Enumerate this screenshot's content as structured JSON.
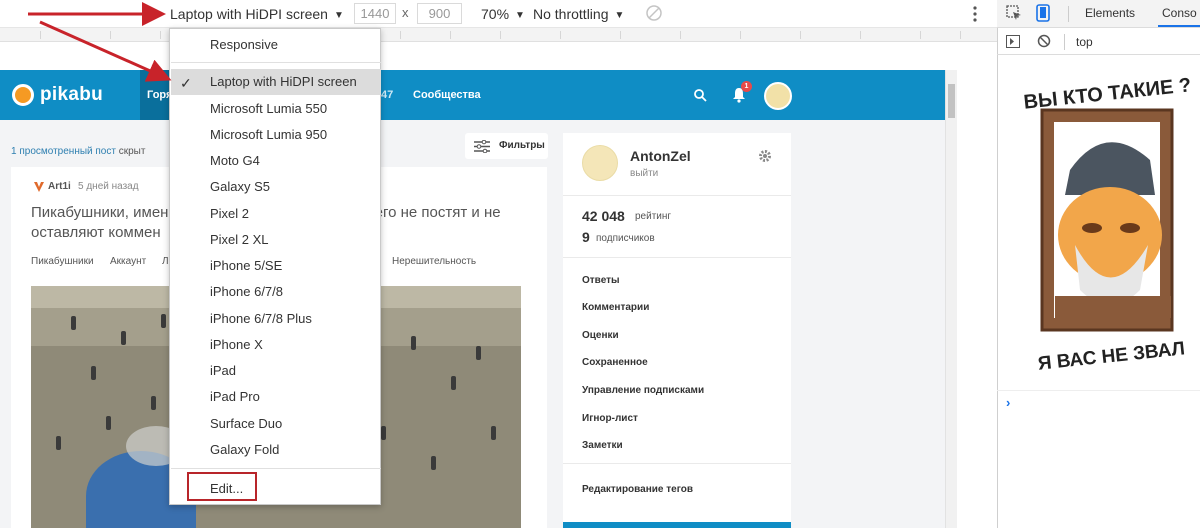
{
  "toolbar": {
    "device": "Laptop with HiDPI screen",
    "width": "1440",
    "height": "900",
    "dim_separator": "x",
    "zoom": "70%",
    "throttling": "No throttling"
  },
  "device_menu": {
    "items": [
      "Responsive",
      "Laptop with HiDPI screen",
      "Microsoft Lumia 550",
      "Microsoft Lumia 950",
      "Moto G4",
      "Galaxy S5",
      "Pixel 2",
      "Pixel 2 XL",
      "iPhone 5/SE",
      "iPhone 6/7/8",
      "iPhone 6/7/8 Plus",
      "iPhone X",
      "iPad",
      "iPad Pro",
      "Surface Duo",
      "Galaxy Fold"
    ],
    "selected": "Laptop with HiDPI screen",
    "edit": "Edit..."
  },
  "site": {
    "logo": "pikabu",
    "nav": {
      "hot": "Горя",
      "partial_24": "47",
      "communities": "Сообщества"
    },
    "bell_count": "1",
    "hidden_posts_link": "1 просмотренный пост",
    "hidden_posts_suffix": " скрыт",
    "filters": "Фильтры",
    "post": {
      "author": "Art1i",
      "date": "5 дней назад",
      "title_part1": "Пикабушники, имен",
      "title_part2": "ичего не постят и не",
      "title_line2": "оставляют коммен",
      "tags": [
        "Пикабушники",
        "Аккаунт",
        "Л",
        "Нерешительность"
      ]
    },
    "sidebar": {
      "username": "AntonZel",
      "logout": "выйти",
      "rating_value": "42 048",
      "rating_label": "рейтинг",
      "subscribers_value": "9",
      "subscribers_label": "подписчиков",
      "links": [
        "Ответы",
        "Комментарии",
        "Оценки",
        "Сохраненное",
        "Управление подписками",
        "Игнор-лист",
        "Заметки"
      ],
      "edit_tags": "Редактирование тегов"
    }
  },
  "devtools": {
    "tabs": [
      "Elements",
      "Conso"
    ],
    "context": "top",
    "prompt": "›"
  },
  "sticker": {
    "top_text": "ВЫ КТО ТАКИЕ ?",
    "bottom_text": "Я ВАС НЕ ЗВАЛ"
  },
  "colors": {
    "pikabu_blue": "#0f8dc5",
    "annotation_red": "#b8252a",
    "devtools_accent": "#1a73e8"
  }
}
